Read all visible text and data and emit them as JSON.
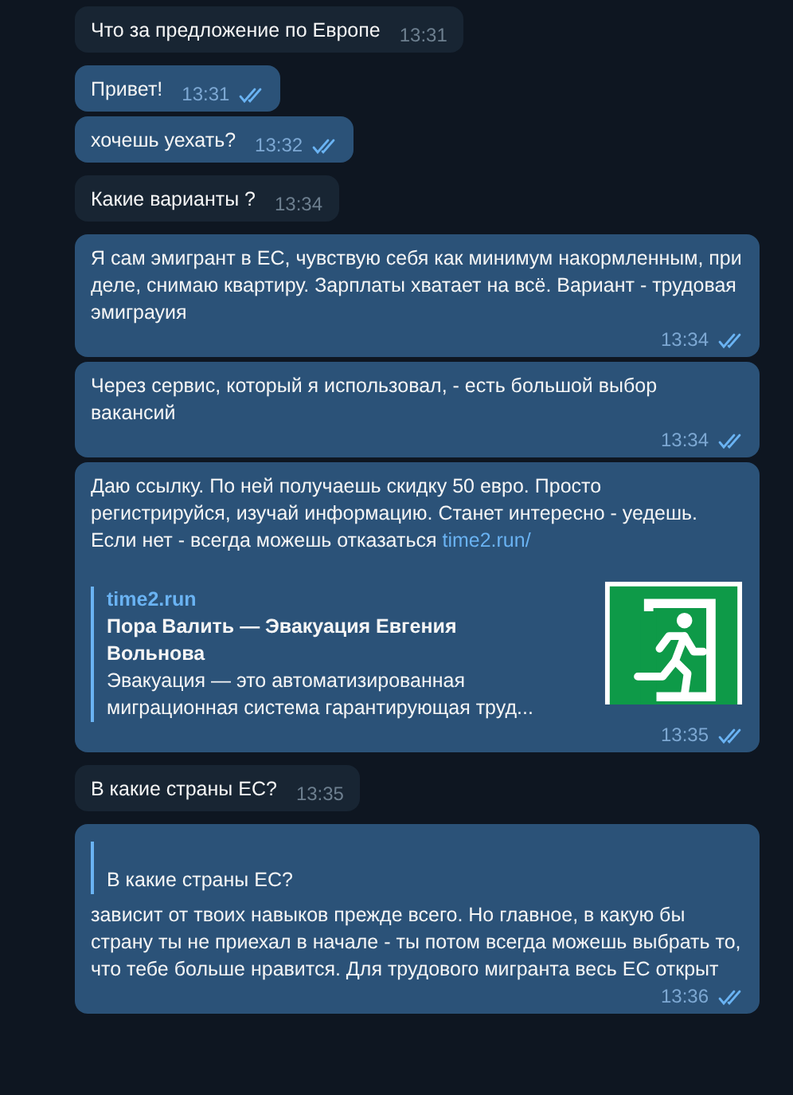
{
  "messages": [
    {
      "kind": "incoming",
      "text": "Что за предложение по Европе",
      "time": "13:31"
    },
    {
      "kind": "outgoing",
      "text": "Привет!",
      "time": "13:31",
      "read": true
    },
    {
      "kind": "outgoing",
      "text": "хочешь уехать?",
      "time": "13:32",
      "read": true
    },
    {
      "kind": "incoming",
      "text": "Какие варианты ?",
      "time": "13:34"
    },
    {
      "kind": "outgoing",
      "text": "Я сам эмигрант в ЕС, чувствую себя как минимум накормленным, при деле, снимаю квартиру. Зарплаты хватает на всё. Вариант - трудовая эмиграуия",
      "time": "13:34",
      "read": true
    },
    {
      "kind": "outgoing",
      "text": "Через сервис, который я использовал, - есть большой выбор вакансий",
      "time": "13:34",
      "read": true
    },
    {
      "kind": "outgoing",
      "text": "Даю ссылку. По ней получаешь скидку 50 евро. Просто регистрируйся, изучай информацию. Станет интересно - уедешь. Если нет - всегда можешь отказаться",
      "link": "time2.run/",
      "preview": {
        "site": "time2.run",
        "title": "Пора Валить — Эвакуация Евгения Вольнова",
        "description": "Эвакуация — это автоматизированная миграционная система гарантирующая труд..."
      },
      "time": "13:35",
      "read": true
    },
    {
      "kind": "incoming",
      "text": "В какие страны ЕС?",
      "time": "13:35"
    },
    {
      "kind": "outgoing",
      "quote": "В какие страны ЕС?",
      "text": "зависит от твоих навыков прежде всего. Но главное, в какую бы страну ты не приехал в начале - ты потом всегда можешь выбрать то, что тебе больше нравится. Для трудового мигранта весь ЕС открыт",
      "time": "13:36",
      "read": true
    }
  ]
}
